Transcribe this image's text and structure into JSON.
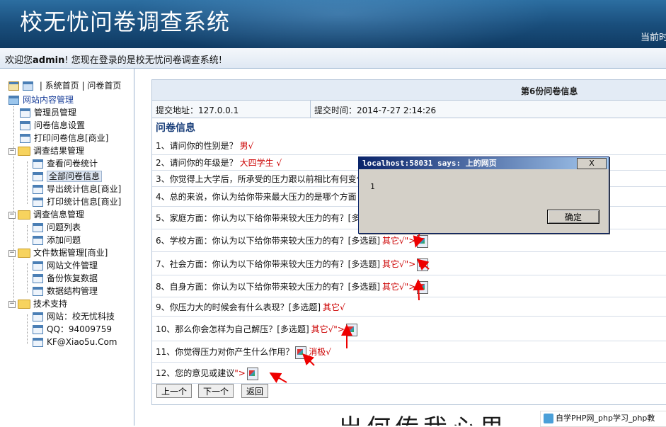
{
  "header": {
    "title": "校无忧问卷调查系统",
    "right_text": "当前时"
  },
  "welcome": {
    "prefix": "欢迎您",
    "user": "admin",
    "suffix": "! 您现在登录的是校无忧问卷调查系统!"
  },
  "sidebar": {
    "top_links": [
      "| 系统首页",
      "|",
      "问卷首页"
    ],
    "root": "网站内容管理",
    "items": [
      {
        "label": "管理员管理",
        "level": 1,
        "type": "page"
      },
      {
        "label": "问卷信息设置",
        "level": 1,
        "type": "page"
      },
      {
        "label": "打印问卷信息[商业]",
        "level": 1,
        "type": "page"
      },
      {
        "label": "调查结果管理",
        "level": 0,
        "type": "folder"
      },
      {
        "label": "查看问卷统计",
        "level": 2,
        "type": "page"
      },
      {
        "label": "全部问卷信息",
        "level": 2,
        "type": "page",
        "selected": true
      },
      {
        "label": "导出统计信息[商业]",
        "level": 2,
        "type": "page"
      },
      {
        "label": "打印统计信息[商业]",
        "level": 2,
        "type": "page"
      },
      {
        "label": "调查信息管理",
        "level": 0,
        "type": "folder"
      },
      {
        "label": "问题列表",
        "level": 2,
        "type": "page"
      },
      {
        "label": "添加问题",
        "level": 2,
        "type": "page"
      },
      {
        "label": "文件数据管理[商业]",
        "level": 0,
        "type": "folder"
      },
      {
        "label": "网站文件管理",
        "level": 2,
        "type": "page"
      },
      {
        "label": "备份恢复数据",
        "level": 2,
        "type": "page"
      },
      {
        "label": "数据结构管理",
        "level": 2,
        "type": "page"
      },
      {
        "label": "技术支持",
        "level": 0,
        "type": "folder"
      },
      {
        "label": "网站：校无忧科技",
        "level": 2,
        "type": "page"
      },
      {
        "label": "QQ：94009759",
        "level": 2,
        "type": "page"
      },
      {
        "label": "KF@Xiao5u.Com",
        "level": 2,
        "type": "page"
      }
    ]
  },
  "main": {
    "title": "第6份问卷信息",
    "address_label": "提交地址：127.0.0.1",
    "time_label": "提交时间：2014-7-27 2:14:26",
    "section_title": "问卷信息",
    "questions": [
      {
        "q": "1、请问你的性别是？",
        "a": "男√",
        "tail": ""
      },
      {
        "q": "2、请问你的年级是？",
        "a": "大四学生 √",
        "tail": ""
      },
      {
        "q": "3、你觉得上大学后，所承受的压力跟以前相比有何变化",
        "a": "",
        "tail": ""
      },
      {
        "q": "4、总的来说，你认为给你带来最大压力的是哪个方面",
        "a": "",
        "tail": ""
      },
      {
        "q": "5、家庭方面：你认为以下给你带来较大压力的有？[多选",
        "a": "",
        "tail": ""
      },
      {
        "q": "6、学校方面：你认为以下给你带来较大压力的有？[多选题]",
        "a": "其它√",
        "tail": "\">"
      },
      {
        "q": "7、社会方面：你认为以下给你带来较大压力的有？[多选题]",
        "a": "其它√",
        "tail": "\">"
      },
      {
        "q": "8、自身方面：你认为以下给你带来较大压力的有？[多选题]",
        "a": "其它√",
        "tail": "\">"
      },
      {
        "q": "9、你压力大的时候会有什么表现？[多选题]",
        "a": "其它√",
        "tail": ""
      },
      {
        "q": "10、那么你会怎样为自己解压？[多选题]",
        "a": "其它√",
        "tail": "\">"
      },
      {
        "q": "11、你觉得压力对你产生什么作用？",
        "a": "消极√",
        "tail": ""
      },
      {
        "q": "12、您的意见或建议",
        "a": "",
        "tail": "\">"
      }
    ],
    "buttons": {
      "prev": "上一个",
      "next": "下一个",
      "back": "返回"
    }
  },
  "dialog": {
    "title": "localhost:58031 says: 上的网页",
    "close": "X",
    "message": "1",
    "ok": "确定"
  },
  "bottom": {
    "deco_text": "出何传我心思",
    "watermark": "自学PHP网_php学习_php教"
  },
  "colors": {
    "header_bg": "#1a4f7d",
    "answer_red": "#cc0000",
    "section_blue": "#1a3f7a",
    "arrow_red": "#ee0000"
  }
}
